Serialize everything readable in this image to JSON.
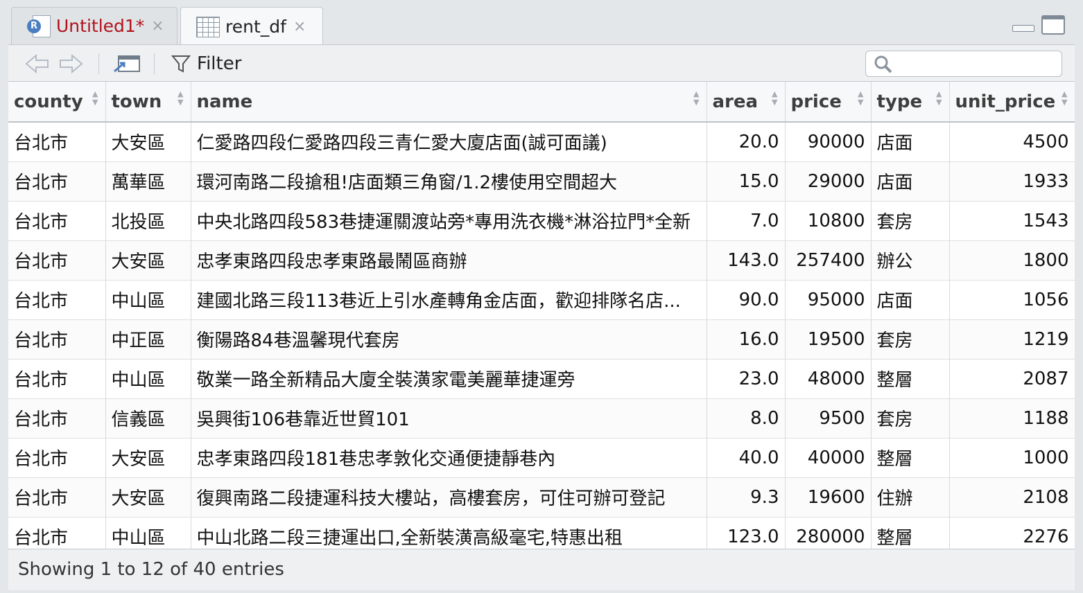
{
  "tabs": [
    {
      "label": "Untitled1*",
      "close": "×"
    },
    {
      "label": "rent_df",
      "close": "×"
    }
  ],
  "toolbar": {
    "filter_label": "Filter",
    "search_placeholder": ""
  },
  "table": {
    "columns": [
      "county",
      "town",
      "name",
      "area",
      "price",
      "type",
      "unit_price"
    ],
    "rows": [
      [
        "台北市",
        "大安區",
        "仁愛路四段仁愛路四段三青仁愛大廈店面(誠可面議)",
        "20.0",
        "90000",
        "店面",
        "4500"
      ],
      [
        "台北市",
        "萬華區",
        "環河南路二段搶租!店面類三角窗/1.2樓使用空間超大",
        "15.0",
        "29000",
        "店面",
        "1933"
      ],
      [
        "台北市",
        "北投區",
        "中央北路四段583巷捷運關渡站旁*專用洗衣機*淋浴拉門*全新",
        "7.0",
        "10800",
        "套房",
        "1543"
      ],
      [
        "台北市",
        "大安區",
        "忠孝東路四段忠孝東路最鬧區商辦",
        "143.0",
        "257400",
        "辦公",
        "1800"
      ],
      [
        "台北市",
        "中山區",
        "建國北路三段113巷近上引水產轉角金店面，歡迎排隊名店...",
        "90.0",
        "95000",
        "店面",
        "1056"
      ],
      [
        "台北市",
        "中正區",
        "衡陽路84巷溫馨現代套房",
        "16.0",
        "19500",
        "套房",
        "1219"
      ],
      [
        "台北市",
        "中山區",
        "敬業一路全新精品大廈全裝潢家電美麗華捷運旁",
        "23.0",
        "48000",
        "整層",
        "2087"
      ],
      [
        "台北市",
        "信義區",
        "吳興街106巷靠近世貿101",
        "8.0",
        "9500",
        "套房",
        "1188"
      ],
      [
        "台北市",
        "大安區",
        "忠孝東路四段181巷忠孝敦化交通便捷靜巷內",
        "40.0",
        "40000",
        "整層",
        "1000"
      ],
      [
        "台北市",
        "大安區",
        "復興南路二段捷運科技大樓站，高樓套房，可住可辦可登記",
        "9.3",
        "19600",
        "住辦",
        "2108"
      ],
      [
        "台北市",
        "中山區",
        "中山北路二段三捷運出口,全新裝潢高級毫宅,特惠出租",
        "123.0",
        "280000",
        "整層",
        "2276"
      ]
    ]
  },
  "footer": {
    "status": "Showing 1 to 12 of 40 entries"
  },
  "icons": [
    "r-script-icon",
    "data-grid-icon",
    "back-arrow-icon",
    "forward-arrow-icon",
    "popout-icon",
    "filter-icon",
    "search-icon",
    "minimize-icon",
    "maximize-icon"
  ]
}
